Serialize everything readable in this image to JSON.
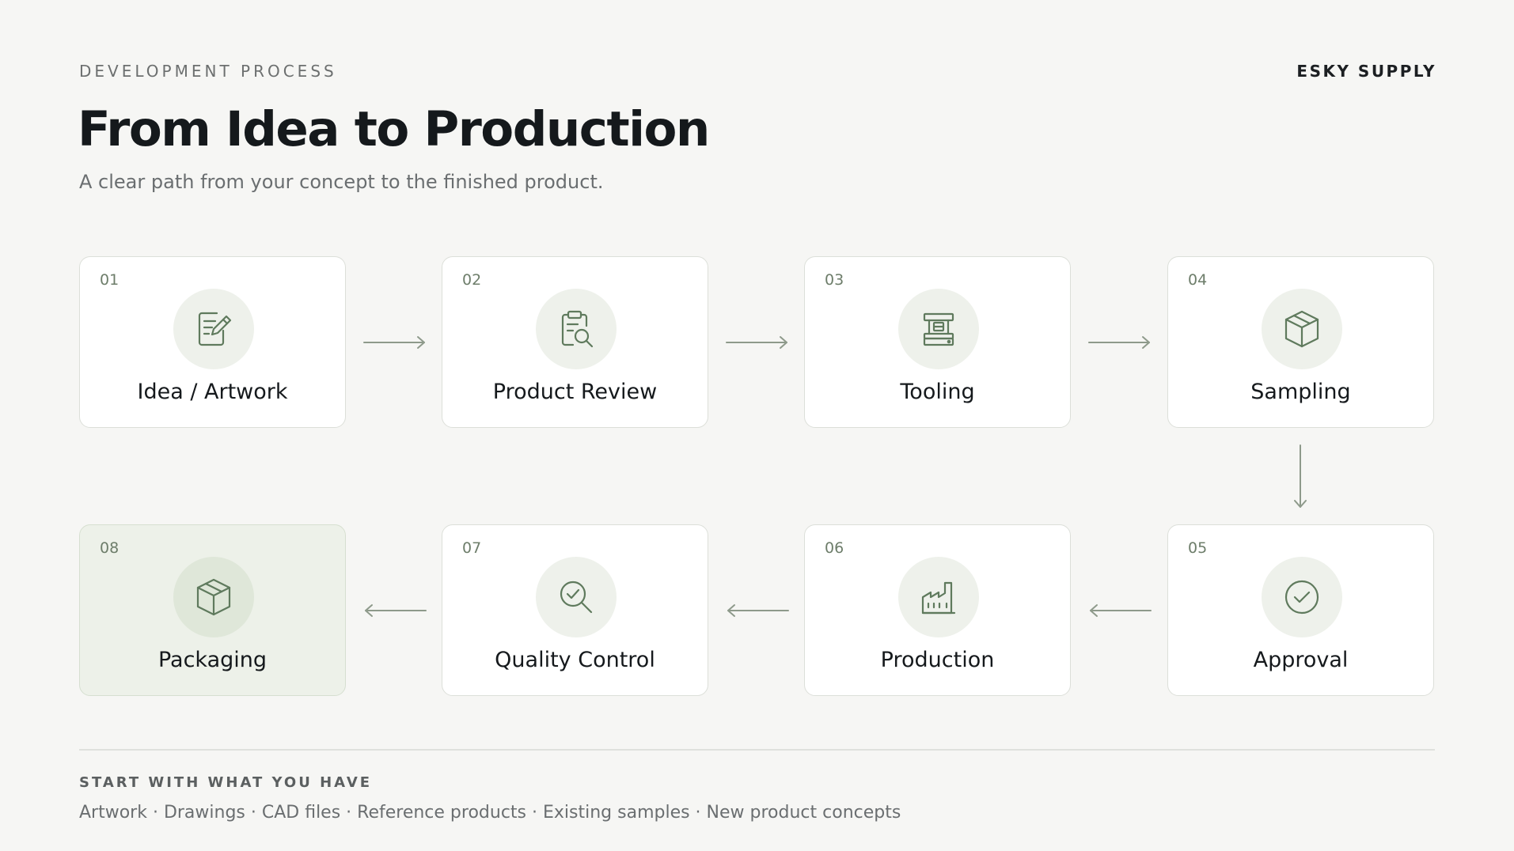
{
  "header": {
    "eyebrow": "DEVELOPMENT PROCESS",
    "brand": "ESKY SUPPLY",
    "title": "From Idea to Production",
    "subtitle": "A clear path from your concept to the finished product."
  },
  "steps": [
    {
      "number": "01",
      "label": "Idea / Artwork",
      "icon": "edit-document-icon"
    },
    {
      "number": "02",
      "label": "Product Review",
      "icon": "clipboard-search-icon"
    },
    {
      "number": "03",
      "label": "Tooling",
      "icon": "tooling-machine-icon"
    },
    {
      "number": "04",
      "label": "Sampling",
      "icon": "box-icon"
    },
    {
      "number": "05",
      "label": "Approval",
      "icon": "check-circle-icon"
    },
    {
      "number": "06",
      "label": "Production",
      "icon": "factory-icon"
    },
    {
      "number": "07",
      "label": "Quality Control",
      "icon": "search-check-icon"
    },
    {
      "number": "08",
      "label": "Packaging",
      "icon": "package-icon",
      "highlighted": true
    }
  ],
  "footer": {
    "title": "START WITH WHAT YOU HAVE",
    "text": "Artwork · Drawings · CAD files · Reference products · Existing samples · New product concepts"
  },
  "colors": {
    "background": "#f6f6f4",
    "accent": "#6f8a6c",
    "icon_circle": "#eef1eb",
    "highlight_card": "#edf1e9"
  }
}
